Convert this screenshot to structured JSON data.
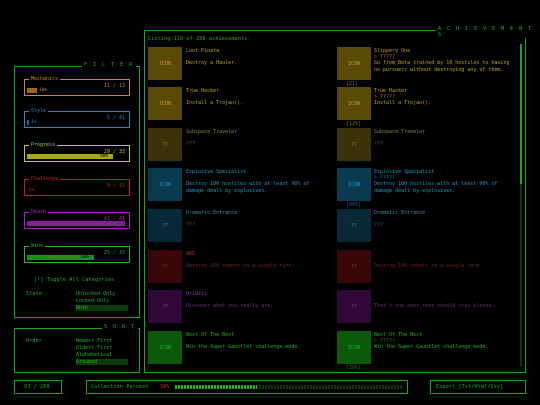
{
  "filter": {
    "title": "F I L T E R",
    "categories": [
      {
        "label": "Mechanics",
        "count": "11 / 13",
        "pct_text": "10%",
        "progress": 0.1,
        "color": "#c98a1a",
        "fill": "#9c6a14"
      },
      {
        "label": "Style",
        "count": "5 / 41",
        "pct_text": "1%",
        "progress": 0.02,
        "color": "#1e8cc0",
        "fill": "#18709a"
      },
      {
        "label": "Progress",
        "count": "29 / 33",
        "pct_text": "90%",
        "progress": 0.88,
        "color": "#c8c81a",
        "fill": "#a8a814"
      },
      {
        "label": "Challenge",
        "count": "0 / 15",
        "pct_text": "0%",
        "progress": 0.0,
        "color": "#c82020",
        "fill": "#a01818"
      },
      {
        "label": "Death",
        "count": "41 / 41",
        "pct_text": "",
        "progress": 1.0,
        "color": "#b01ec8",
        "fill": "#8c18a0"
      },
      {
        "label": "Wins",
        "count": "25 / 37",
        "pct_text": "68%",
        "progress": 0.68,
        "color": "#1fb81f",
        "fill": "#18901a"
      }
    ],
    "toggle_all": "[!] Toggle All Categories",
    "state_label": "State",
    "state_options": [
      "Unlocked Only",
      "Locked Only",
      "Both"
    ],
    "state_selected": 2
  },
  "sort": {
    "title": "S O R T",
    "order_label": "Order",
    "options": [
      "Newest First",
      "Oldest First",
      "Alphabetical",
      "Grouped"
    ],
    "selected": 3
  },
  "achievements": {
    "title": "A C H I E V E M E N T S",
    "listing": "Listing 110 of 256 achievements:",
    "icon_text": "ICON",
    "locked_icon_text": "??",
    "hidden_desc": "???",
    "left": [
      {
        "name": "Loot Pinata",
        "desc": "Destroy a Hauler.",
        "date": "",
        "unlocked": true,
        "color": "#c8a01a",
        "tile": "#5a4a08"
      },
      {
        "name": "True Hacker",
        "desc": "Install a Trojan().",
        "date": "",
        "unlocked": true,
        "color": "#c8a01a",
        "tile": "#5a4a08"
      },
      {
        "name": "Subspace Traveler",
        "desc": "???",
        "date": "",
        "unlocked": false,
        "color": "#8a8a40",
        "tile": "#3a3208"
      },
      {
        "name": "Explosive Specialist",
        "desc": "Destroy 100 hostiles with at least 90% of damage dealt by explosives.",
        "date": "",
        "unlocked": true,
        "color": "#1e9ac8",
        "tile": "#0a3a50"
      },
      {
        "name": "Dramatic Entrance",
        "desc": "???",
        "date": "",
        "unlocked": false,
        "color": "#3a8aa0",
        "tile": "#082838"
      },
      {
        "name": "WRD",
        "desc": "Destroy 100 robots in a single turn.",
        "date": "",
        "unlocked": false,
        "color": "#a03030",
        "tile": "#380808"
      },
      {
        "name": "Oridzis",
        "desc": "Discover what you really are.",
        "date": "",
        "unlocked": false,
        "color": "#9a3aa8",
        "tile": "#300838"
      },
      {
        "name": "Best Of The Best",
        "desc": "Win the Super Gauntlet challenge mode.",
        "date": "",
        "unlocked": true,
        "color": "#1fb81f",
        "tile": "#0a5a0a"
      }
    ],
    "right": [
      {
        "name": "Slippery One",
        "sub": "> ?????",
        "desc": "Go from Beta trained by 10 hostiles to having no pursuers without destroying any of them.",
        "date": "[21]",
        "unlocked": true,
        "color": "#c8a01a",
        "tile": "#5a4a08"
      },
      {
        "name": "True Hacker",
        "sub": "> ?????",
        "desc": "Install a Trojan().",
        "date": "[12%]",
        "unlocked": true,
        "color": "#c8a01a",
        "tile": "#5a4a08"
      },
      {
        "name": "Subspace Traveler",
        "sub": "",
        "desc": "???",
        "date": "",
        "unlocked": false,
        "color": "#8a8a40",
        "tile": "#3a3208"
      },
      {
        "name": "Explosive Specialist",
        "sub": "> ?????",
        "desc": "Destroy 100 hostiles with at least 90% of damage dealt by explosives.",
        "date": "[90%]",
        "unlocked": true,
        "color": "#1e9ac8",
        "tile": "#0a3a50"
      },
      {
        "name": "Dramatic Entrance",
        "sub": "",
        "desc": "???",
        "date": "",
        "unlocked": false,
        "color": "#3a8aa0",
        "tile": "#082838"
      },
      {
        "name": "",
        "sub": "",
        "desc": "Destroy 100 robots in a single turn.",
        "date": "",
        "unlocked": false,
        "color": "#a03030",
        "tile": "#380808"
      },
      {
        "name": "",
        "sub": "",
        "desc": "That's one door that should stay closed.",
        "date": "",
        "unlocked": false,
        "color": "#9a3aa8",
        "tile": "#300838"
      },
      {
        "name": "Best Of The Best",
        "sub": "> ?????",
        "desc": "Win the Super Gauntlet challenge mode.",
        "date": "[20%]",
        "unlocked": true,
        "color": "#1fb81f",
        "tile": "#0a5a0a"
      }
    ]
  },
  "footer": {
    "count": "93 / 260",
    "collection_label": "Collection Percent",
    "collection_pct": "36%",
    "collection_progress": 0.36,
    "export": "Export [Txt/Html/Csv]"
  }
}
